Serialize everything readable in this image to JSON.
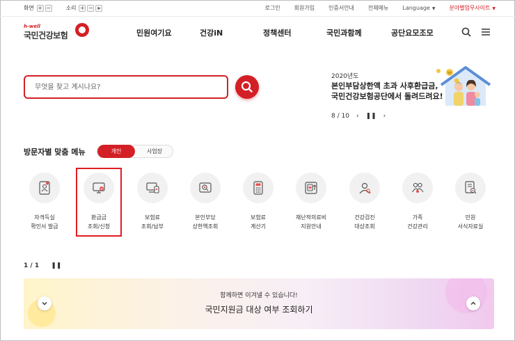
{
  "utility": {
    "screen_label": "화면",
    "sound_label": "소리",
    "login": "로그인",
    "signup": "회원가입",
    "cert_guide": "인증서안내",
    "full_menu": "전체메뉴",
    "language": "Language",
    "partner_site": "분야별업무사이트"
  },
  "logo": {
    "tagline": "h-well",
    "name": "국민건강보험"
  },
  "nav": [
    "민원여기요",
    "건강iN",
    "정책센터",
    "국민과함께",
    "공단요모조모"
  ],
  "search": {
    "placeholder": "무엇을 찾고 계시나요?"
  },
  "banner": {
    "year": "2020년도",
    "line1": "본인부담상한액 초과 사후환급금,",
    "line2": "국민건강보험공단에서 돌려드려요!",
    "page": "8 / 10"
  },
  "visitor_menu": {
    "title": "방문자별 맞춤 메뉴",
    "tab_personal": "개인",
    "tab_business": "사업장",
    "items": [
      {
        "l1": "자격득실",
        "l2": "확인서 발급"
      },
      {
        "l1": "환급금",
        "l2": "조회/신청"
      },
      {
        "l1": "보험료",
        "l2": "조회/납부"
      },
      {
        "l1": "본인부담",
        "l2": "상한액조회"
      },
      {
        "l1": "보험료",
        "l2": "계산기"
      },
      {
        "l1": "재난적의료비",
        "l2": "지원안내"
      },
      {
        "l1": "건강검진",
        "l2": "대상조회"
      },
      {
        "l1": "가족",
        "l2": "건강관리"
      },
      {
        "l1": "민원",
        "l2": "서식자료실"
      }
    ]
  },
  "bottom": {
    "page": "1 / 1",
    "sub": "함께하면 이겨낼 수 있습니다!",
    "main": "국민지원금 대상 여부 조회하기"
  },
  "colors": {
    "accent": "#d32026",
    "highlight": "#e11b22"
  }
}
